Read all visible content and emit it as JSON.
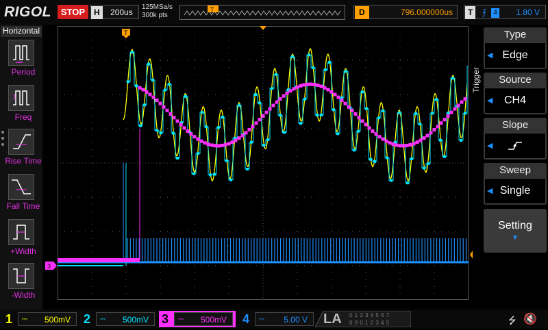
{
  "topbar": {
    "brand": "RIGOL",
    "run_status": "STOP",
    "horizontal_key": "H",
    "timebase": "200us",
    "sample_rate": "125MSa/s",
    "memory_depth": "300k pts",
    "delay_key": "D",
    "delay": "796.000000us",
    "trigger_key": "T",
    "trigger_source": "4",
    "trigger_level": "1.80 V"
  },
  "left_panel": {
    "title": "Horizontal",
    "items": [
      {
        "label": "Period"
      },
      {
        "label": "Freq"
      },
      {
        "label": "Rise Time"
      },
      {
        "label": "Fall Time"
      },
      {
        "label": "+Width"
      },
      {
        "label": "-Width"
      }
    ]
  },
  "right_panel": {
    "side_label": "Trigger",
    "type": {
      "header": "Type",
      "value": "Edge"
    },
    "source": {
      "header": "Source",
      "value": "CH4"
    },
    "slope": {
      "header": "Slope"
    },
    "sweep": {
      "header": "Sweep",
      "value": "Single"
    },
    "setting": "Setting"
  },
  "markers": {
    "trigger_tag": "T",
    "ch3_marker": "3",
    "trigger_level_marker": "T"
  },
  "channels": [
    {
      "num": "1",
      "scale": "500mV",
      "color": "#ffff00"
    },
    {
      "num": "2",
      "scale": "500mV",
      "color": "#00e5ff"
    },
    {
      "num": "3",
      "scale": "500mV",
      "color": "#ff30ff"
    },
    {
      "num": "4",
      "scale": "5.00 V",
      "color": "#1e90ff"
    }
  ],
  "la": {
    "label": "LA",
    "bits_row1": "0 1 2 3  4 5 6 7",
    "bits_row2": "8 9 0 1  2 3 4 5"
  },
  "colors": {
    "ch1": "#ffff00",
    "ch2": "#00e5ff",
    "ch3": "#ff30ff",
    "ch4": "#1e90ff",
    "trigger": "#ffa000",
    "stop": "#d61e1e"
  },
  "icons": [
    "usb-icon",
    "speaker-mute-icon"
  ]
}
